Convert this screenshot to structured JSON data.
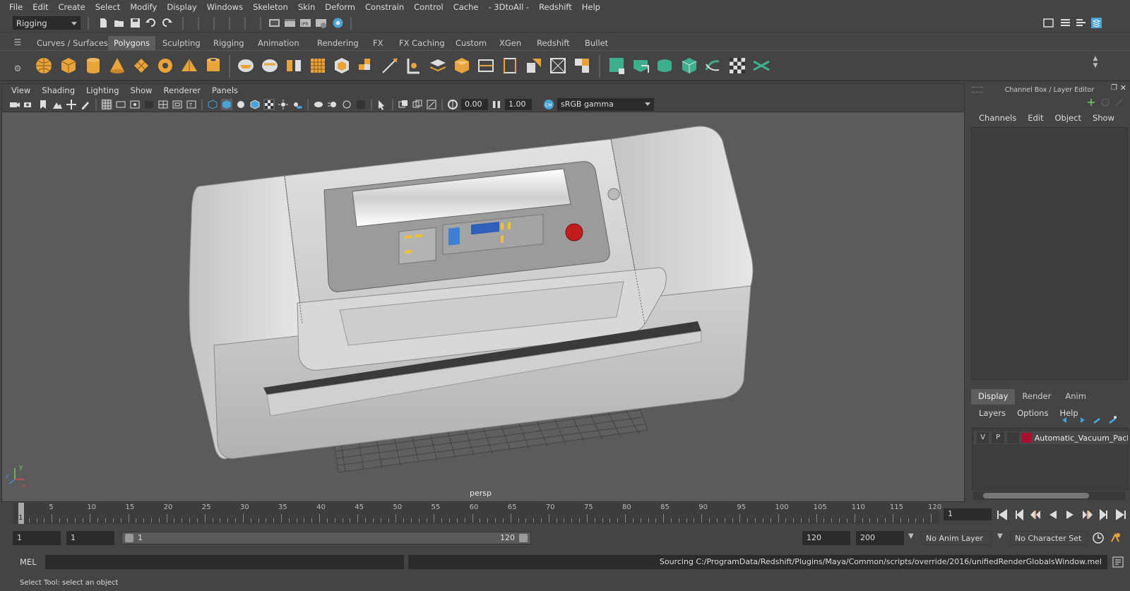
{
  "menubar": {
    "items": [
      "File",
      "Edit",
      "Create",
      "Select",
      "Modify",
      "Display",
      "Windows",
      "Skeleton",
      "Skin",
      "Deform",
      "Constrain",
      "Control",
      "Cache",
      "- 3DtoAll -",
      "Redshift",
      "Help"
    ]
  },
  "statusline": {
    "mode": "Rigging"
  },
  "shelf": {
    "tabs": [
      "Curves / Surfaces",
      "Polygons",
      "Sculpting",
      "Rigging",
      "Animation",
      "Rendering",
      "FX",
      "FX Caching",
      "Custom",
      "XGen",
      "Redshift",
      "Bullet"
    ],
    "active_tab": "Polygons"
  },
  "viewport": {
    "menu": [
      "View",
      "Shading",
      "Lighting",
      "Show",
      "Renderer",
      "Panels"
    ],
    "exposure": "0.00",
    "gamma": "1.00",
    "color_space": "sRGB gamma",
    "camera_label": "persp"
  },
  "channel_box": {
    "title": "Channel Box / Layer Editor",
    "menu": [
      "Channels",
      "Edit",
      "Object",
      "Show"
    ]
  },
  "layer_editor": {
    "tabs": [
      "Display",
      "Render",
      "Anim"
    ],
    "active_tab": "Display",
    "menu": [
      "Layers",
      "Options",
      "Help"
    ],
    "layer": {
      "visible": "V",
      "playback": "P",
      "name": "Automatic_Vacuum_Pack",
      "color": "#a6112e"
    }
  },
  "timeslider": {
    "ticks": [
      "1",
      "5",
      "10",
      "15",
      "20",
      "25",
      "30",
      "35",
      "40",
      "45",
      "50",
      "55",
      "60",
      "65",
      "70",
      "75",
      "80",
      "85",
      "90",
      "95",
      "100",
      "105",
      "110",
      "115",
      "120"
    ],
    "current_frame": "1"
  },
  "range": {
    "start_frame": "1",
    "playback_start": "1",
    "slider_start": "1",
    "slider_end": "120",
    "playback_end": "120",
    "end_frame": "200",
    "anim_layer": "No Anim Layer",
    "character_set": "No Character Set"
  },
  "command_line": {
    "mode": "MEL",
    "output": "Sourcing C:/ProgramData/Redshift/Plugins/Maya/Common/scripts/override/2016/unifiedRenderGlobalsWindow.mel"
  },
  "help_line": "Select Tool: select an object",
  "colors": {
    "accent": "#5d5d5d",
    "layer_red": "#a6112e"
  }
}
